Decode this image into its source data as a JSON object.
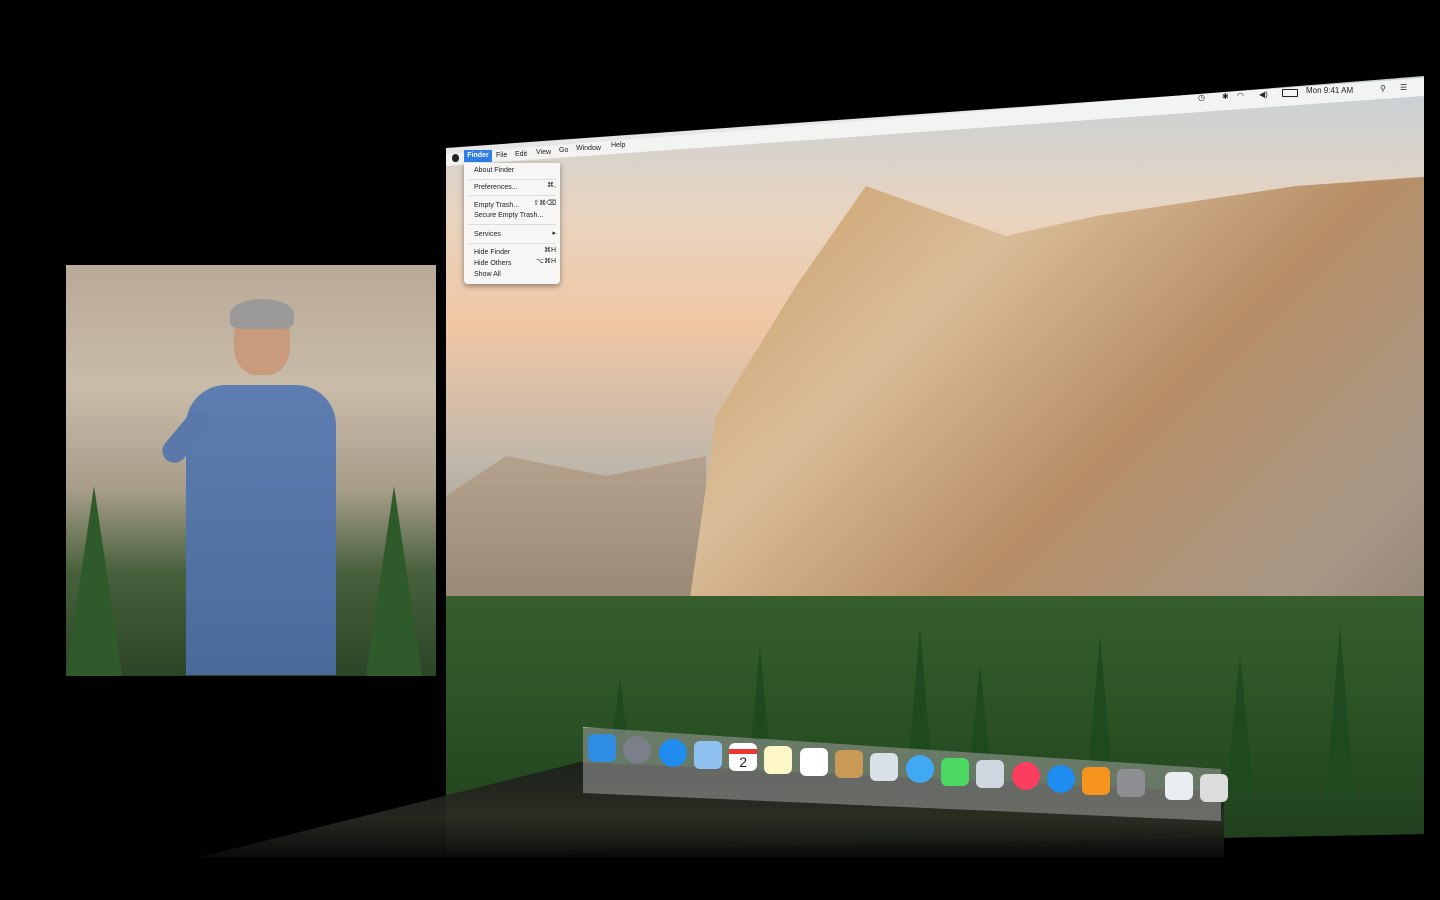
{
  "menubar": {
    "apple_icon": "apple-icon",
    "items": [
      "Finder",
      "File",
      "Edit",
      "View",
      "Go",
      "Window",
      "Help"
    ]
  },
  "finder_menu": {
    "items": [
      {
        "label": "About Finder",
        "shortcut": ""
      },
      {
        "label": "Preferences...",
        "shortcut": "⌘,"
      },
      {
        "label": "Empty Trash...",
        "shortcut": "⇧⌘⌫"
      },
      {
        "label": "Secure Empty Trash...",
        "shortcut": ""
      },
      {
        "label": "Services",
        "shortcut": "▸"
      },
      {
        "label": "Hide Finder",
        "shortcut": "⌘H"
      },
      {
        "label": "Hide Others",
        "shortcut": "⌥⌘H"
      },
      {
        "label": "Show All",
        "shortcut": ""
      }
    ]
  },
  "statusbar": {
    "clock": "Mon 9:41 AM",
    "icons": [
      "time-machine-icon",
      "bluetooth-icon",
      "wifi-icon",
      "volume-icon",
      "battery-icon",
      "spotlight-icon",
      "notification-center-icon"
    ]
  },
  "dock": {
    "icons": [
      {
        "name": "finder-icon",
        "color": "#2f8de4"
      },
      {
        "name": "launchpad-icon",
        "color": "#7a7f89"
      },
      {
        "name": "safari-icon",
        "color": "#1f8cf0"
      },
      {
        "name": "mail-icon",
        "color": "#8ec1f0"
      },
      {
        "name": "calendar-icon",
        "color": "#ffffff"
      },
      {
        "name": "notes-icon",
        "color": "#fdf6c7"
      },
      {
        "name": "reminders-icon",
        "color": "#ffffff"
      },
      {
        "name": "contacts-icon",
        "color": "#c89a55"
      },
      {
        "name": "preview-icon",
        "color": "#d8e0e8"
      },
      {
        "name": "messages-icon",
        "color": "#3fa9f5"
      },
      {
        "name": "facetime-icon",
        "color": "#4bd964"
      },
      {
        "name": "iphoto-icon",
        "color": "#cfd8e0"
      },
      {
        "name": "itunes-icon",
        "color": "#fc3d5e"
      },
      {
        "name": "app-store-icon",
        "color": "#1e8cf0"
      },
      {
        "name": "ibooks-icon",
        "color": "#f7941d"
      },
      {
        "name": "system-preferences-icon",
        "color": "#8e8e93"
      },
      {
        "name": "documents-folder-icon",
        "color": "#e9eef0"
      },
      {
        "name": "trash-icon",
        "color": "#dcdcdc"
      }
    ],
    "calendar_day": "2"
  }
}
